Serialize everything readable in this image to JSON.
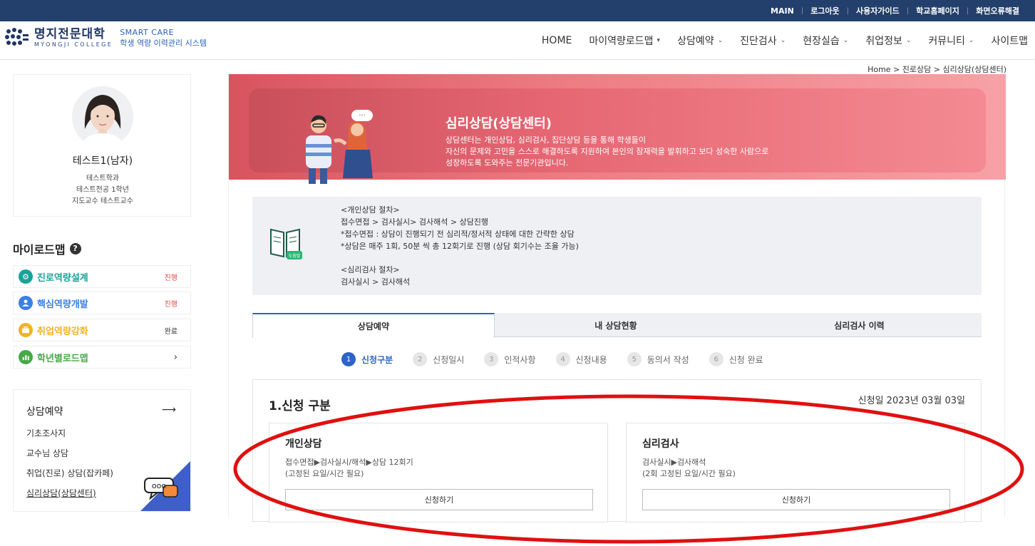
{
  "util": [
    "MAIN",
    "로그아웃",
    "사용자가이드",
    "학교홈페이지",
    "화면오류해결"
  ],
  "logo": {
    "korean": "명지전문대학",
    "english": "MYONGJI COLLEGE",
    "smart_care": "SMART CARE",
    "system": "학생 역량 이력관리 시스템"
  },
  "nav": [
    {
      "label": "HOME",
      "chevron": ""
    },
    {
      "label": "마이역량로드맵",
      "chevron": "▾"
    },
    {
      "label": "상담예약",
      "chevron": "⌄"
    },
    {
      "label": "진단검사",
      "chevron": "⌄"
    },
    {
      "label": "현장실습",
      "chevron": "⌄"
    },
    {
      "label": "취업정보",
      "chevron": "⌄"
    },
    {
      "label": "커뮤니티",
      "chevron": "⌄"
    },
    {
      "label": "사이트맵",
      "chevron": ""
    }
  ],
  "breadcrumb": "Home > 진로상담 > 심리상담(상담센터)",
  "profile": {
    "name": "테스트1(남자)",
    "dept": "테스트학과",
    "major": "테스트전공 1학년",
    "advisor": "지도교수 테스트교수"
  },
  "roadmap": {
    "title": "마이로드맵",
    "help": "?",
    "items": [
      {
        "label": "진로역량설계",
        "status": "진행",
        "color": "#17a398",
        "glyph": "⚙",
        "status_color": "#e04848"
      },
      {
        "label": "핵심역량개발",
        "status": "진행",
        "color": "#3b7fe0",
        "glyph": "●",
        "status_color": "#e04848"
      },
      {
        "label": "취업역량강화",
        "status": "완료",
        "color": "#f0b323",
        "glyph": "■",
        "status_color": "#333333"
      },
      {
        "label": "학년별로드맵",
        "status": "›",
        "color": "#49a84a",
        "glyph": "▮",
        "status_color": "#333333"
      }
    ]
  },
  "consult": {
    "title": "상담예약",
    "arrow": "⟶",
    "links": [
      "기초조사지",
      "교수님 상담",
      "취업(진로) 상담(잡카페)",
      "심리상담(상담센터)"
    ],
    "chat_text": "ooo"
  },
  "banner": {
    "title": "심리상담(상담센터)",
    "lines": [
      "상담센터는 개인상담, 심리검사, 집단상담 등을 통해 학생들이",
      "자신의 문제와 고민을 스스로 해결하도록 지원하여 본인의 잠재력을 발휘하고 보다 성숙한 사람으로",
      "성장하도록 도와주는 전문기관입니다."
    ],
    "bubble": "···"
  },
  "info": {
    "book_tag": "도움말",
    "lines": [
      "<개인상담 절차>",
      "접수면접 > 검사실시> 검사해석 > 상담진행",
      "*접수면접 : 상담이 진행되기 전 심리적/정서적 상태에 대한 간략한 상담",
      "*상담은 매주 1회, 50분 씩 총 12회기로 진행 (상담 회기수는 조율 가능)",
      "",
      "<심리검사 절차>",
      "검사실시 > 검사해석"
    ]
  },
  "tabs": [
    "상담예약",
    "내 상담현황",
    "심리검사 이력"
  ],
  "steps": [
    {
      "num": "1",
      "label": "신청구분"
    },
    {
      "num": "2",
      "label": "신청일시"
    },
    {
      "num": "3",
      "label": "인적사항"
    },
    {
      "num": "4",
      "label": "신청내용"
    },
    {
      "num": "5",
      "label": "동의서 작성"
    },
    {
      "num": "6",
      "label": "신청 완료"
    }
  ],
  "form": {
    "title": "1.신청 구분",
    "date": "신청일 2023년 03월 03일",
    "cards": [
      {
        "title": "개인상담",
        "line1": "접수면접▶검사실시/해석▶상담 12회기",
        "line2": "(고정된 요일/시간 필요)",
        "button": "신청하기"
      },
      {
        "title": "심리검사",
        "line1": "검사실시▶검사해석",
        "line2": "(2회 고정된 요일/시간 필요)",
        "button": "신청하기"
      }
    ]
  },
  "colors": {
    "topbar": "#233f6b",
    "accent": "#2c64c7",
    "banner": "#e56672",
    "annotation": "#e01010"
  }
}
